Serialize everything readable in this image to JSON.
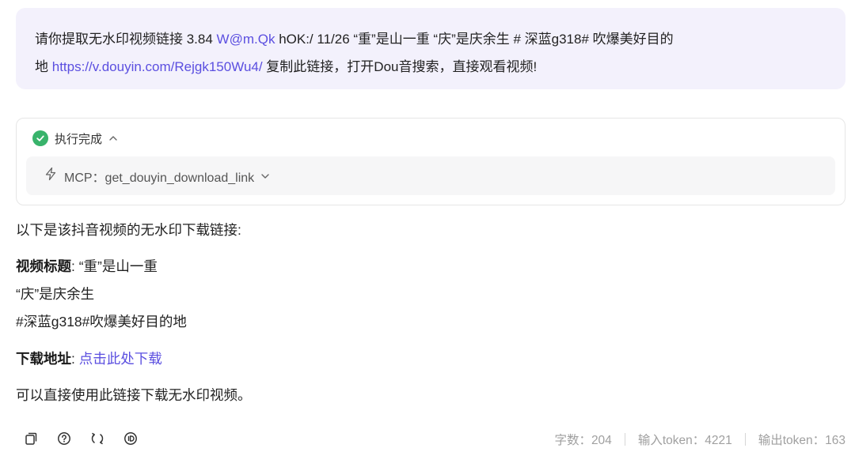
{
  "user_message": {
    "line1_prefix": "请你提取无水印视频链接 3.84 ",
    "line1_link": "W@m.Qk",
    "line1_suffix": " hOK:/ 11/26 “重”是山一重 “庆”是庆余生 # 深蓝g318# 吹爆美好目的",
    "line2_prefix": "地 ",
    "line2_link": "https://v.douyin.com/Rejgk150Wu4/",
    "line2_suffix": " 复制此链接，打开Dou音搜索，直接观看视频!"
  },
  "tool_call": {
    "status": "执行完成",
    "status_icon": "check-circle-icon",
    "name": "MCP：get_douyin_download_link",
    "icon": "bolt-icon"
  },
  "answer": {
    "intro": "以下是该抖音视频的无水印下载链接:",
    "title_label": "视频标题",
    "title_value": ": “重”是山一重",
    "title_line2": "“庆”是庆余生",
    "title_line3": "#深蓝g318#吹爆美好目的地",
    "download_label": "下载地址",
    "download_sep": ": ",
    "download_link": "点击此处下载",
    "note": "可以直接使用此链接下载无水印视频。"
  },
  "actions": {
    "icons": [
      "copy-icon",
      "help-icon",
      "refresh-icon",
      "id-icon"
    ]
  },
  "stats": {
    "chars": "字数：204",
    "input_tokens": "输入token：4221",
    "output_tokens": "输出token：163"
  },
  "colors": {
    "accent": "#5b4fe0",
    "user_bubble_bg": "#f3f1fc",
    "success": "#38b36b"
  }
}
